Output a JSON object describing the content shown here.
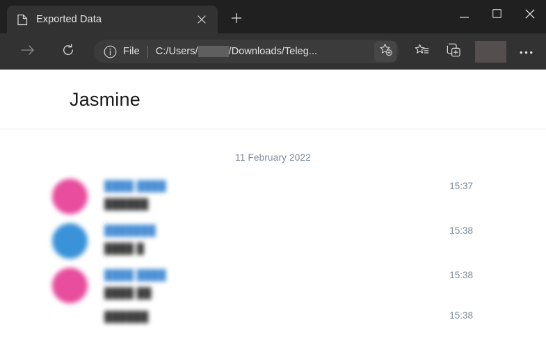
{
  "browser": {
    "tab": {
      "title": "Exported Data",
      "favicon_icon": "document-page-icon",
      "close_icon": "close-icon"
    },
    "new_tab_icon": "plus-icon",
    "window_controls": {
      "minimize_icon": "minimize-icon",
      "maximize_icon": "maximize-icon",
      "close_icon": "close-icon"
    },
    "toolbar": {
      "forward_icon": "arrow-right-icon",
      "refresh_icon": "refresh-icon",
      "info_icon": "info-circle-icon",
      "scheme_label": "File",
      "url_prefix": "C:/Users/",
      "url_suffix": "/Downloads/Teleg...",
      "url_redacted": true,
      "bookmark_star_icon": "star-add-icon",
      "favorites_icon": "favorites-star-list-icon",
      "collections_icon": "collections-add-icon",
      "profile_redacted": true,
      "more_icon": "ellipsis-horizontal-icon"
    }
  },
  "page": {
    "title": "Jasmine",
    "date_separator": "11 February 2022",
    "messages": [
      {
        "avatar_color": "#e84d9e",
        "has_avatar": true,
        "sender": "████ ████",
        "text": "██████",
        "time": "15:37",
        "joined": false
      },
      {
        "avatar_color": "#3a93d8",
        "has_avatar": true,
        "sender": "███████",
        "text": "████ █",
        "time": "15:38",
        "joined": false
      },
      {
        "avatar_color": "#e84d9e",
        "has_avatar": true,
        "sender": "████ ████",
        "text": "████ ██",
        "time": "15:38",
        "joined": false
      },
      {
        "avatar_color": "",
        "has_avatar": false,
        "sender": "",
        "text": "██████",
        "time": "15:38",
        "joined": true
      }
    ]
  }
}
